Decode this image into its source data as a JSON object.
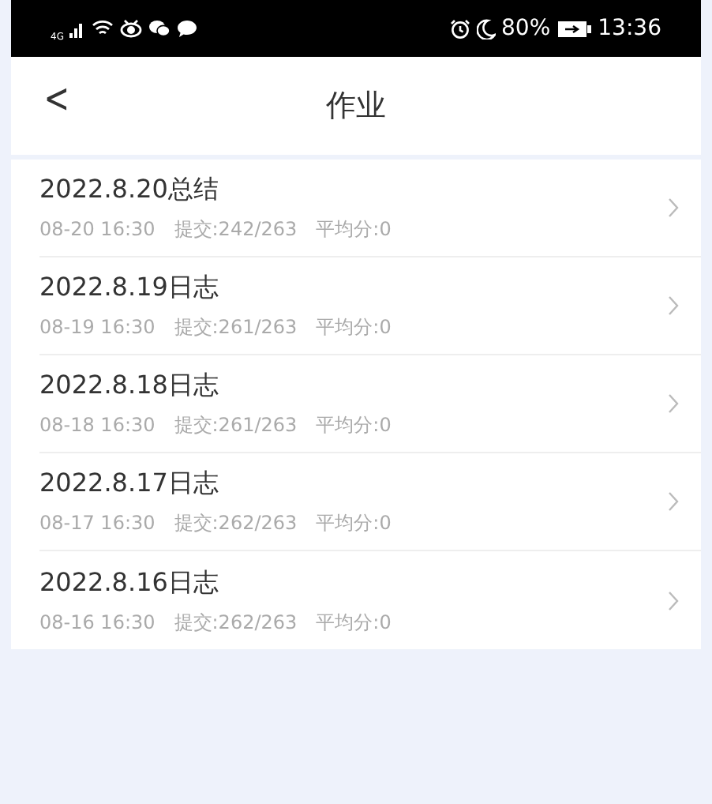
{
  "status_bar": {
    "network": "4G",
    "battery": "80%",
    "time": "13:36"
  },
  "header": {
    "back": "<",
    "title": "作业"
  },
  "assignments": [
    {
      "title": "2022.8.20总结",
      "time": "08-20 16:30",
      "submitted": "提交:242/263",
      "average": "平均分:0"
    },
    {
      "title": "2022.8.19日志",
      "time": "08-19 16:30",
      "submitted": "提交:261/263",
      "average": "平均分:0"
    },
    {
      "title": "2022.8.18日志",
      "time": "08-18 16:30",
      "submitted": "提交:261/263",
      "average": "平均分:0"
    },
    {
      "title": "2022.8.17日志",
      "time": "08-17 16:30",
      "submitted": "提交:262/263",
      "average": "平均分:0"
    },
    {
      "title": "2022.8.16日志",
      "time": "08-16 16:30",
      "submitted": "提交:262/263",
      "average": "平均分:0"
    }
  ]
}
